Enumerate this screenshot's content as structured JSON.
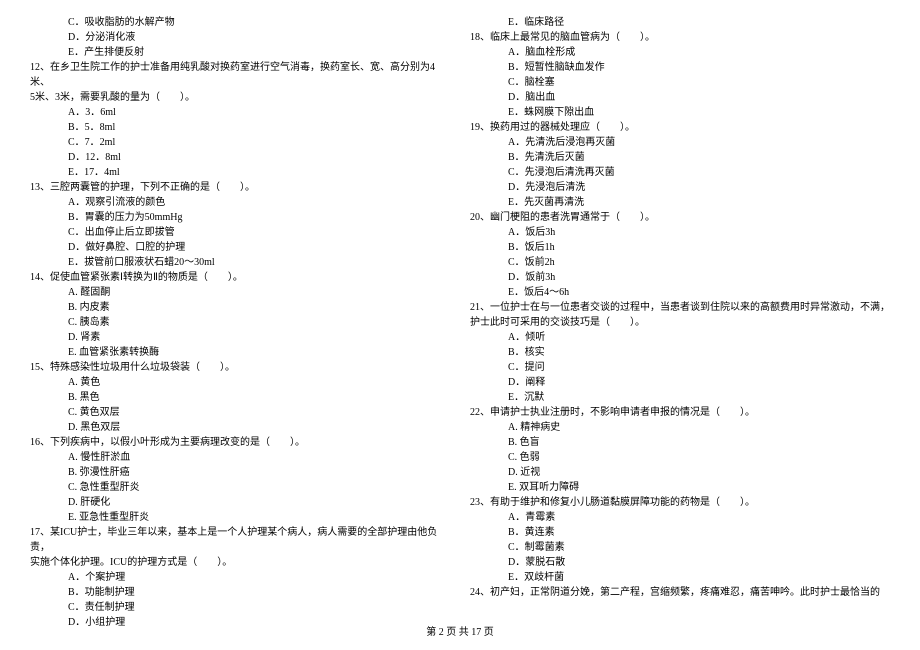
{
  "col1": {
    "q11opts": [
      "C．吸收脂肪的水解产物",
      "D．分泌消化液",
      "E．产生排便反射"
    ],
    "q12": "12、在乡卫生院工作的护士准备用纯乳酸对换药室进行空气消毒，换药室长、宽、高分别为4米、",
    "q12b": "5米、3米，需要乳酸的量为（　　）。",
    "q12opts": [
      "A．3．6ml",
      "B．5．8ml",
      "C．7．2ml",
      "D．12．8ml",
      "E．17．4ml"
    ],
    "q13": "13、三腔两囊管的护理，下列不正确的是（　　）。",
    "q13opts": [
      "A．观察引流液的颜色",
      "B．胃囊的压力为50mmHg",
      "C．出血停止后立即拔管",
      "D．做好鼻腔、口腔的护理",
      "E．拔管前口服液状石蜡20～30ml"
    ],
    "q14": "14、促使血管紧张素Ⅰ转换为Ⅱ的物质是（　　）。",
    "q14opts": [
      "A. 醛固酮",
      "B. 内皮素",
      "C. 胰岛素",
      "D. 肾素",
      "E. 血管紧张素转换酶"
    ],
    "q15": "15、特殊感染性垃圾用什么垃圾袋装（　　）。",
    "q15opts": [
      "A. 黄色",
      "B. 黑色",
      "C. 黄色双层",
      "D. 黑色双层"
    ],
    "q16": "16、下列疾病中，以假小叶形成为主要病理改变的是（　　）。",
    "q16opts": [
      "A. 慢性肝淤血",
      "B. 弥漫性肝癌",
      "C. 急性重型肝炎",
      "D. 肝硬化",
      "E. 亚急性重型肝炎"
    ],
    "q17a": "17、某ICU护士，毕业三年以来，基本上是一个人护理某个病人，病人需要的全部护理由他负责，",
    "q17b": "实施个体化护理。ICU的护理方式是（　　）。",
    "q17opts": [
      "A．个案护理",
      "B．功能制护理",
      "C．责任制护理",
      "D．小组护理"
    ]
  },
  "col2": {
    "q17e": "E．临床路径",
    "q18": "18、临床上最常见的脑血管病为（　　）。",
    "q18opts": [
      "A．脑血栓形成",
      "B．短暂性脑缺血发作",
      "C．脑栓塞",
      "D．脑出血",
      "E．蛛网膜下隙出血"
    ],
    "q19": "19、换药用过的器械处理应（　　）。",
    "q19opts": [
      "A．先清洗后浸泡再灭菌",
      "B．先清洗后灭菌",
      "C．先浸泡后清洗再灭菌",
      "D．先浸泡后清洗",
      "E．先灭菌再清洗"
    ],
    "q20": "20、幽门梗阻的患者洗胃通常于（　　）。",
    "q20opts": [
      "A．饭后3h",
      "B．饭后1h",
      "C．饭前2h",
      "D．饭前3h",
      "E．饭后4～6h"
    ],
    "q21a": "21、一位护士在与一位患者交谈的过程中，当患者谈到住院以来的高额费用时异常激动，不满，",
    "q21b": "护士此时可采用的交谈技巧是（　　）。",
    "q21opts": [
      "A．倾听",
      "B．核实",
      "C．提问",
      "D．阐释",
      "E．沉默"
    ],
    "q22": "22、申请护士执业注册时，不影响申请者申报的情况是（　　）。",
    "q22opts": [
      "A. 精神病史",
      "B. 色盲",
      "C. 色弱",
      "D. 近视",
      "E. 双耳听力障碍"
    ],
    "q23": "23、有助于维护和修复小儿肠道黏膜屏障功能的药物是（　　）。",
    "q23opts": [
      "A．青霉素",
      "B．黄连素",
      "C．制霉菌素",
      "D．蒙脱石散",
      "E．双歧杆菌"
    ],
    "q24": "24、初产妇，正常阴道分娩，第二产程，宫缩频繁，疼痛难忍，痛苦呻吟。此时护士最恰当的"
  },
  "footer": "第 2 页 共 17 页"
}
